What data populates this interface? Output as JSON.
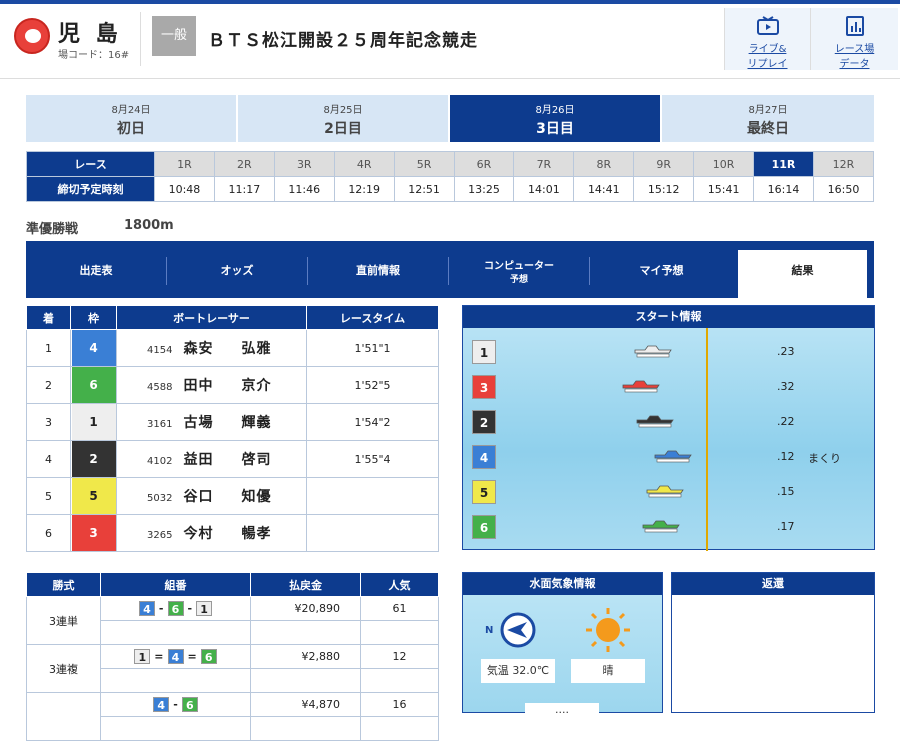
{
  "header": {
    "venue": "児 島",
    "venue_code": "場コード：16#",
    "grade": "一般",
    "race_name": "ＢＴＳ松江開設２５周年記念競走",
    "live_label_1": "ライブ&",
    "live_label_2": "リプレイ",
    "data_label_1": "レース場",
    "data_label_2": "データ"
  },
  "days": [
    {
      "date": "8月24日",
      "name": "初日"
    },
    {
      "date": "8月25日",
      "name": "2日目"
    },
    {
      "date": "8月26日",
      "name": "3日目"
    },
    {
      "date": "8月27日",
      "name": "最終日"
    }
  ],
  "race_table": {
    "race_label": "レース",
    "time_label": "締切予定時刻",
    "races": [
      "1R",
      "2R",
      "3R",
      "4R",
      "5R",
      "6R",
      "7R",
      "8R",
      "9R",
      "10R",
      "11R",
      "12R"
    ],
    "times": [
      "10:48",
      "11:17",
      "11:46",
      "12:19",
      "12:51",
      "13:25",
      "14:01",
      "14:41",
      "15:12",
      "15:41",
      "16:14",
      "16:50"
    ]
  },
  "race_info": {
    "type": "準優勝戦",
    "distance": "1800m"
  },
  "tabs": [
    "出走表",
    "オッズ",
    "直前情報",
    "コンピューター",
    "予想",
    "マイ予想",
    "結果"
  ],
  "colors": {
    "w1": "#eeeeee",
    "w2": "#333333",
    "w3": "#e8403a",
    "w4": "#3a7fd5",
    "w5": "#f0e84a",
    "w6": "#44b04a",
    "navy": "#0d3b8e"
  },
  "result": {
    "headers": [
      "着",
      "枠",
      "ボートレーサー",
      "レースタイム"
    ],
    "rows": [
      {
        "rank": "1",
        "waku": "4",
        "no": "4154",
        "sei": "森安",
        "mei": "弘雅",
        "time": "1'51\"1"
      },
      {
        "rank": "2",
        "waku": "6",
        "no": "4588",
        "sei": "田中",
        "mei": "京介",
        "time": "1'52\"5"
      },
      {
        "rank": "3",
        "waku": "1",
        "no": "3161",
        "sei": "古場",
        "mei": "輝義",
        "time": "1'54\"2"
      },
      {
        "rank": "4",
        "waku": "2",
        "no": "4102",
        "sei": "益田",
        "mei": "啓司",
        "time": "1'55\"4"
      },
      {
        "rank": "5",
        "waku": "5",
        "no": "5032",
        "sei": "谷口",
        "mei": "知優",
        "time": ""
      },
      {
        "rank": "6",
        "waku": "3",
        "no": "3265",
        "sei": "今村",
        "mei": "暢孝",
        "time": ""
      }
    ]
  },
  "start_info": {
    "title": "スタート情報",
    "rows": [
      {
        "course": "1",
        "time": ".23",
        "note": ""
      },
      {
        "course": "3",
        "time": ".32",
        "note": ""
      },
      {
        "course": "2",
        "time": ".22",
        "note": ""
      },
      {
        "course": "4",
        "time": ".12",
        "note": "まくり"
      },
      {
        "course": "5",
        "time": ".15",
        "note": ""
      },
      {
        "course": "6",
        "time": ".17",
        "note": ""
      }
    ]
  },
  "payout": {
    "headers": [
      "勝式",
      "組番",
      "払戻金",
      "人気"
    ],
    "rows": [
      {
        "type": "3連単",
        "combo": [
          "4",
          "-",
          "6",
          "-",
          "1"
        ],
        "amount": "¥20,890",
        "pop": "61"
      },
      {
        "type": "3連複",
        "combo": [
          "1",
          "=",
          "4",
          "=",
          "6"
        ],
        "amount": "¥2,880",
        "pop": "12"
      },
      {
        "type": "",
        "combo": [
          "4",
          "-",
          "6"
        ],
        "amount": "¥4,870",
        "pop": "16"
      }
    ]
  },
  "weather": {
    "title": "水面気象情報",
    "wind_dir": "N",
    "temp_label": "気温",
    "temp": "32.0℃",
    "weather": "晴",
    "extra": "...."
  },
  "refund": {
    "title": "返還"
  }
}
